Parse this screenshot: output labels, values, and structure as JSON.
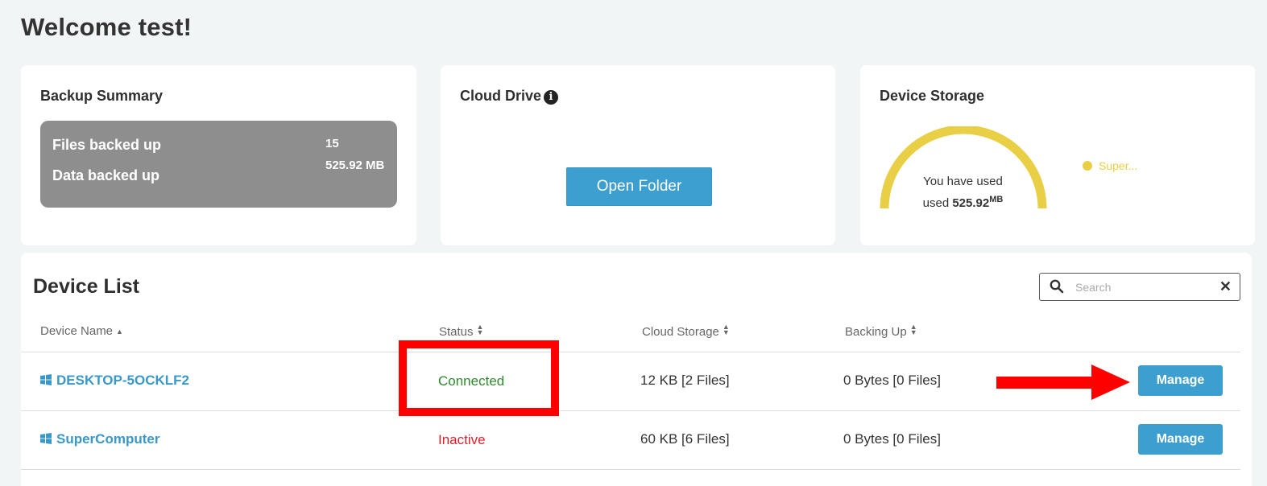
{
  "welcome": "Welcome test!",
  "backup_summary": {
    "title": "Backup Summary",
    "files_label": "Files backed up",
    "files_value": "15",
    "data_label": "Data backed up",
    "data_value": "525.92 MB"
  },
  "cloud_drive": {
    "title": "Cloud Drive",
    "info_icon": "info-icon",
    "open_button": "Open Folder"
  },
  "device_storage": {
    "title": "Device Storage",
    "gauge_line1": "You have used",
    "gauge_line2_prefix": "used ",
    "gauge_amount": "525.92",
    "gauge_unit": "MB",
    "legend_label": "Super...",
    "gauge_color": "#e8cf45"
  },
  "device_list": {
    "title": "Device List",
    "search_placeholder": "Search",
    "columns": {
      "device_name": "Device Name",
      "status": "Status",
      "cloud_storage": "Cloud Storage",
      "backing_up": "Backing Up"
    },
    "rows": [
      {
        "name": "DESKTOP-5OCKLF2",
        "status": "Connected",
        "cloud_storage": "12 KB [2 Files]",
        "backing_up": "0 Bytes [0 Files]",
        "action": "Manage"
      },
      {
        "name": "SuperComputer",
        "status": "Inactive",
        "cloud_storage": "60 KB [6 Files]",
        "backing_up": "0 Bytes [0 Files]",
        "action": "Manage"
      }
    ]
  },
  "colors": {
    "accent": "#3d9fd0",
    "connected": "#2e8a2e",
    "inactive": "#e0202a",
    "annotation": "#ff0000"
  }
}
